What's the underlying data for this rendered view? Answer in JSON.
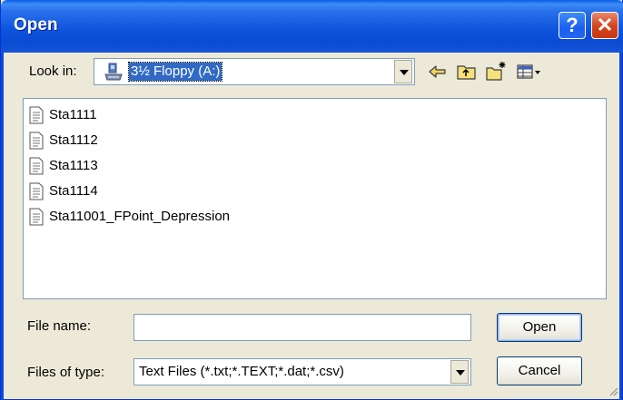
{
  "window": {
    "title": "Open"
  },
  "titlebar": {
    "help_label": "?",
    "close_label": "✕"
  },
  "look_in": {
    "label": "Look in:",
    "value": "3½ Floppy (A:)"
  },
  "files": [
    {
      "name": "Sta1111"
    },
    {
      "name": "Sta1112"
    },
    {
      "name": "Sta1113"
    },
    {
      "name": "Sta1114"
    },
    {
      "name": "Sta11001_FPoint_Depression"
    }
  ],
  "file_name": {
    "label": "File name:",
    "value": "",
    "placeholder": ""
  },
  "file_type": {
    "label": "Files of type:",
    "value": "Text Files (*.txt;*.TEXT;*.dat;*.csv)"
  },
  "buttons": {
    "open": "Open",
    "cancel": "Cancel"
  },
  "icons": {
    "drive": "floppy-drive-icon",
    "back": "back-arrow-icon",
    "up": "up-folder-icon",
    "new_folder": "new-folder-icon",
    "view": "view-menu-icon",
    "file": "text-file-icon"
  },
  "colors": {
    "titlebar": "#0a4bd3",
    "selection": "#316ac5",
    "face": "#ece9d8",
    "close": "#d2421a"
  }
}
